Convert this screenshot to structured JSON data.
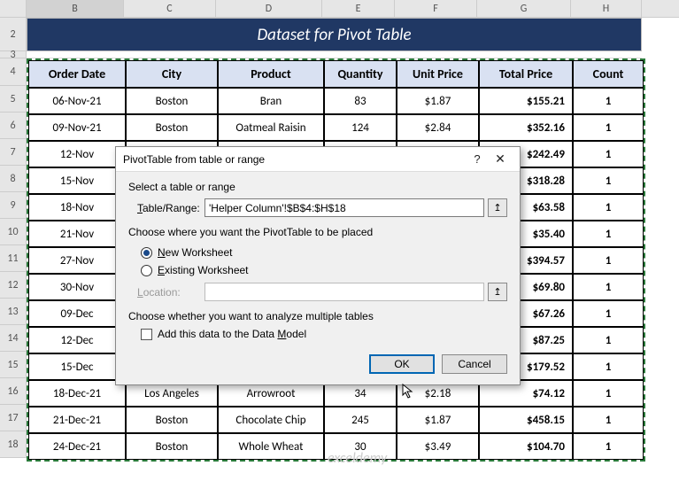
{
  "columns": [
    "B",
    "C",
    "D",
    "E",
    "F",
    "G",
    "H"
  ],
  "row_numbers": [
    2,
    3,
    4,
    5,
    6,
    7,
    8,
    9,
    10,
    11,
    12,
    13,
    14,
    15,
    16,
    17,
    18
  ],
  "title": "Dataset for Pivot Table",
  "headers": {
    "order_date": "Order Date",
    "city": "City",
    "product": "Product",
    "quantity": "Quantity",
    "unit_price": "Unit Price",
    "total_price": "Total Price",
    "count": "Count"
  },
  "rows": [
    {
      "date": "06-Nov-21",
      "city": "Boston",
      "product": "Bran",
      "qty": "83",
      "unit": "$1.87",
      "total": "$155.21",
      "count": "1"
    },
    {
      "date": "09-Nov-21",
      "city": "Boston",
      "product": "Oatmeal Raisin",
      "qty": "124",
      "unit": "$2.84",
      "total": "$352.16",
      "count": "1"
    },
    {
      "date": "12-Nov",
      "city": "",
      "product": "",
      "qty": "",
      "unit": "",
      "total": "$242.49",
      "count": "1"
    },
    {
      "date": "15-Nov",
      "city": "",
      "product": "",
      "qty": "",
      "unit": "",
      "total": "$318.28",
      "count": "1"
    },
    {
      "date": "18-Nov",
      "city": "",
      "product": "",
      "qty": "",
      "unit": "",
      "total": "$63.58",
      "count": "1"
    },
    {
      "date": "21-Nov",
      "city": "",
      "product": "",
      "qty": "",
      "unit": "",
      "total": "$35.40",
      "count": "1"
    },
    {
      "date": "27-Nov",
      "city": "",
      "product": "",
      "qty": "",
      "unit": "",
      "total": "$394.57",
      "count": "1"
    },
    {
      "date": "30-Nov",
      "city": "",
      "product": "",
      "qty": "",
      "unit": "",
      "total": "$69.80",
      "count": "1"
    },
    {
      "date": "09-Dec",
      "city": "",
      "product": "",
      "qty": "",
      "unit": "",
      "total": "$67.26",
      "count": "1"
    },
    {
      "date": "12-Dec",
      "city": "",
      "product": "",
      "qty": "",
      "unit": "",
      "total": "$87.25",
      "count": "1"
    },
    {
      "date": "15-Dec",
      "city": "",
      "product": "",
      "qty": "",
      "unit": "",
      "total": "$179.52",
      "count": "1"
    },
    {
      "date": "18-Dec-21",
      "city": "Los Angeles",
      "product": "Arrowroot",
      "qty": "34",
      "unit": "$2.18",
      "total": "$74.12",
      "count": "1"
    },
    {
      "date": "21-Dec-21",
      "city": "Boston",
      "product": "Chocolate Chip",
      "qty": "245",
      "unit": "$1.87",
      "total": "$458.15",
      "count": "1"
    },
    {
      "date": "24-Dec-21",
      "city": "Boston",
      "product": "Whole Wheat",
      "qty": "30",
      "unit": "$3.49",
      "total": "$104.70",
      "count": "1"
    }
  ],
  "dialog": {
    "title": "PivotTable from table or range",
    "help": "?",
    "close": "✕",
    "section1": "Select a table or range",
    "range_label": "Table/Range:",
    "range_pre": "T",
    "range_value": "'Helper Column'!$B$4:$H$18",
    "section2": "Choose where you want the PivotTable to be placed",
    "radio_new_pre": "N",
    "radio_new": "ew Worksheet",
    "radio_existing_pre": "E",
    "radio_existing": "xisting Worksheet",
    "location_pre": "L",
    "location_label": "ocation:",
    "section3": "Choose whether you want to analyze multiple tables",
    "checkbox_pre": "Add this data to the Data ",
    "checkbox_letter": "M",
    "checkbox_post": "odel",
    "ok": "OK",
    "cancel": "Cancel",
    "collapse_icon": "↥"
  },
  "watermark": "exceldemy"
}
